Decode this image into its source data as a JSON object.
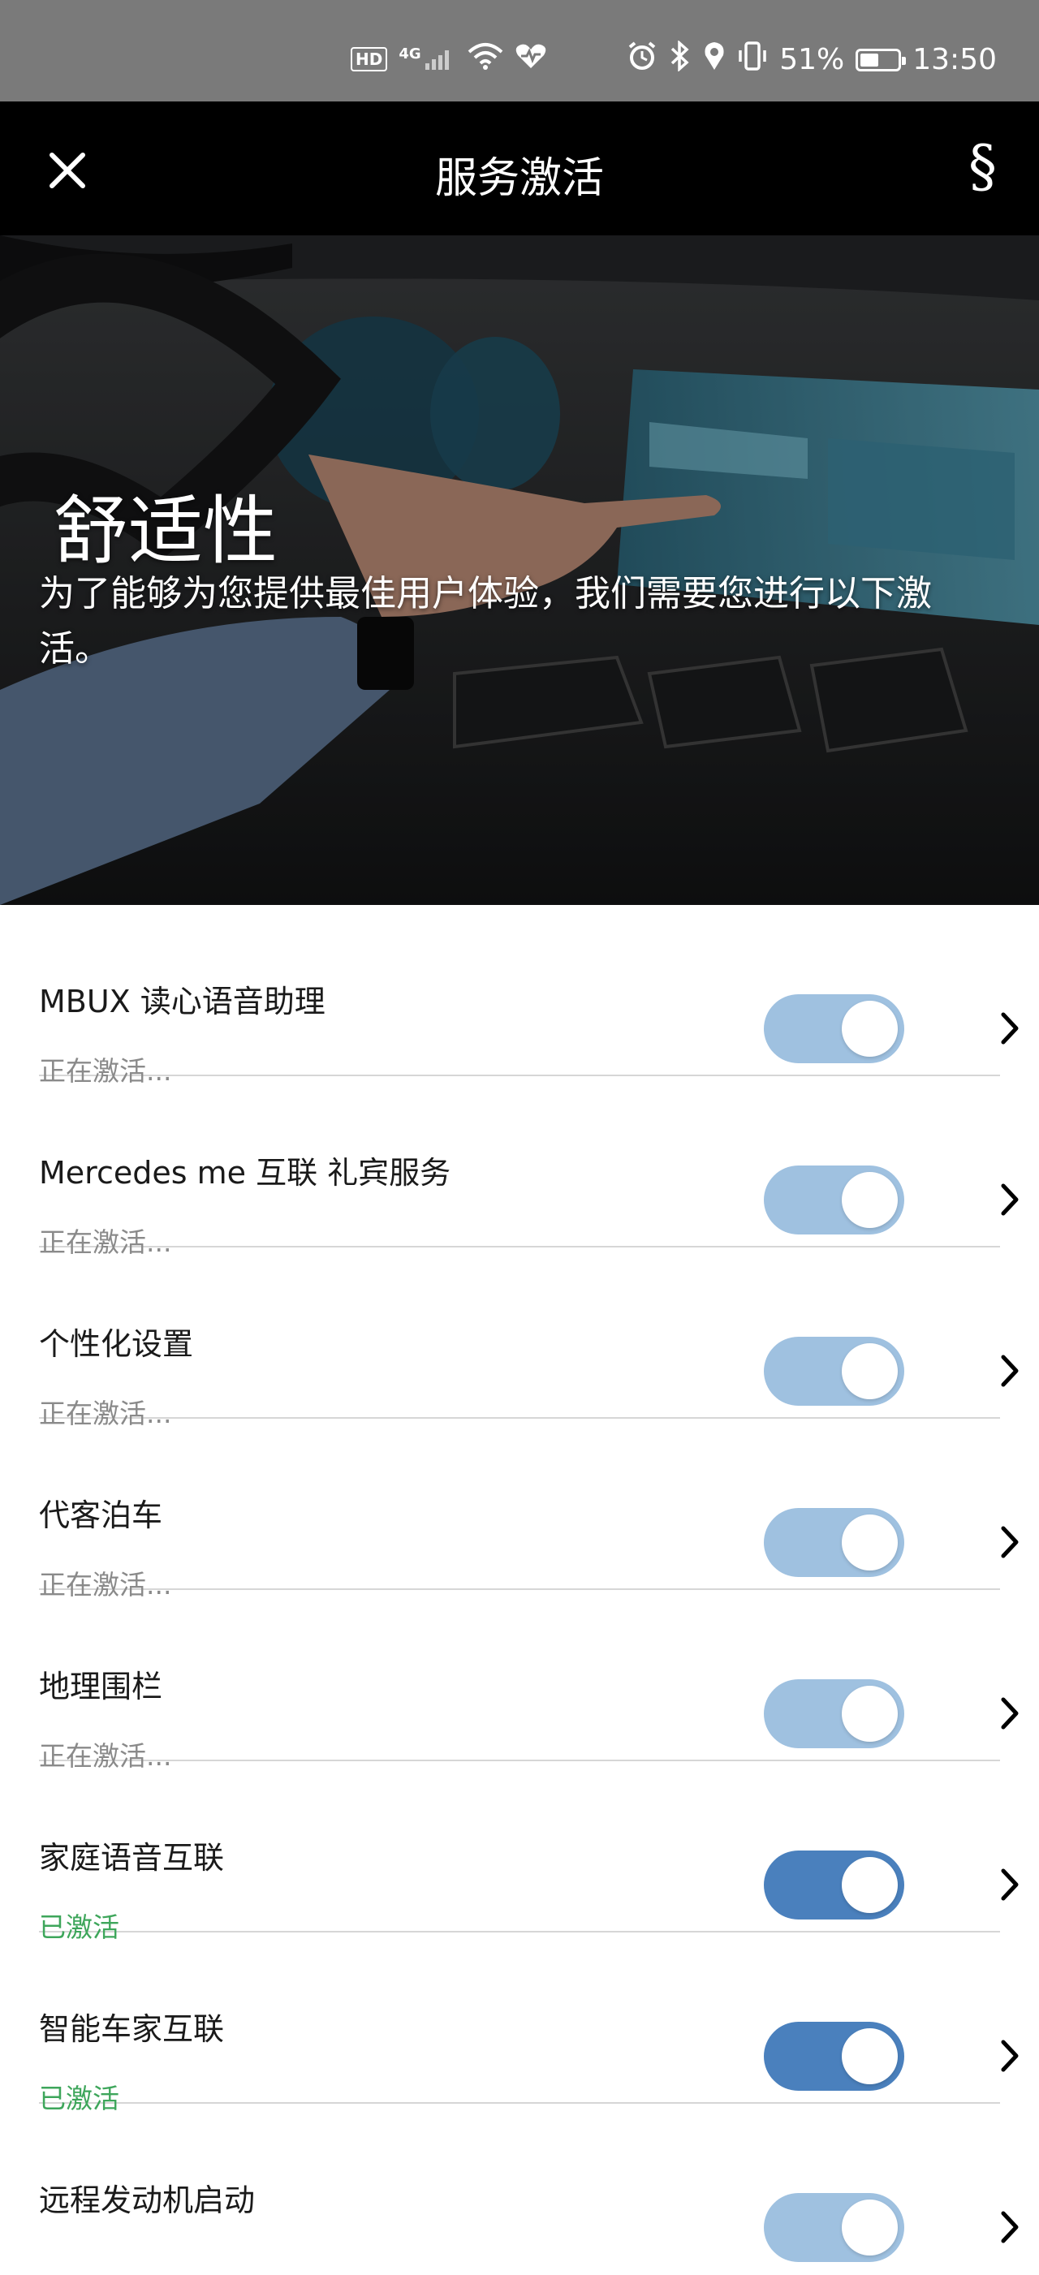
{
  "status_bar": {
    "left_badges": [
      "HD",
      "4G"
    ],
    "battery_percent": "51%",
    "battery_level": 0.51,
    "time": "13:50",
    "icons": [
      "hd-icon",
      "4g-signal-icon",
      "wifi-icon",
      "health-icon",
      "alarm-icon",
      "bluetooth-icon",
      "location-icon",
      "vibrate-icon",
      "battery-icon"
    ]
  },
  "header": {
    "title": "服务激活",
    "close_icon": "close-icon",
    "legal_label": "§"
  },
  "hero": {
    "title": "舒适性",
    "subtitle": "为了能够为您提供最佳用户体验，我们需要您进行以下激活。"
  },
  "services": [
    {
      "title": "MBUX 读心语音助理",
      "status": "正在激活...",
      "state": "pending"
    },
    {
      "title": "Mercedes me 互联 礼宾服务",
      "status": "正在激活...",
      "state": "pending"
    },
    {
      "title": "个性化设置",
      "status": "正在激活...",
      "state": "pending"
    },
    {
      "title": "代客泊车",
      "status": "正在激活...",
      "state": "pending"
    },
    {
      "title": "地理围栏",
      "status": "正在激活...",
      "state": "pending"
    },
    {
      "title": "家庭语音互联",
      "status": "已激活",
      "state": "active"
    },
    {
      "title": "智能车家互联",
      "status": "已激活",
      "state": "active"
    },
    {
      "title": "远程发动机启动",
      "status": "",
      "state": "pending"
    }
  ],
  "colors": {
    "header_bg": "#000000",
    "status_bar_bg": "#7a7a7a",
    "toggle_pending": "#9fc1e0",
    "toggle_active": "#4a80bd",
    "status_active": "#3ea65b",
    "status_pending": "#8a8a8a"
  }
}
